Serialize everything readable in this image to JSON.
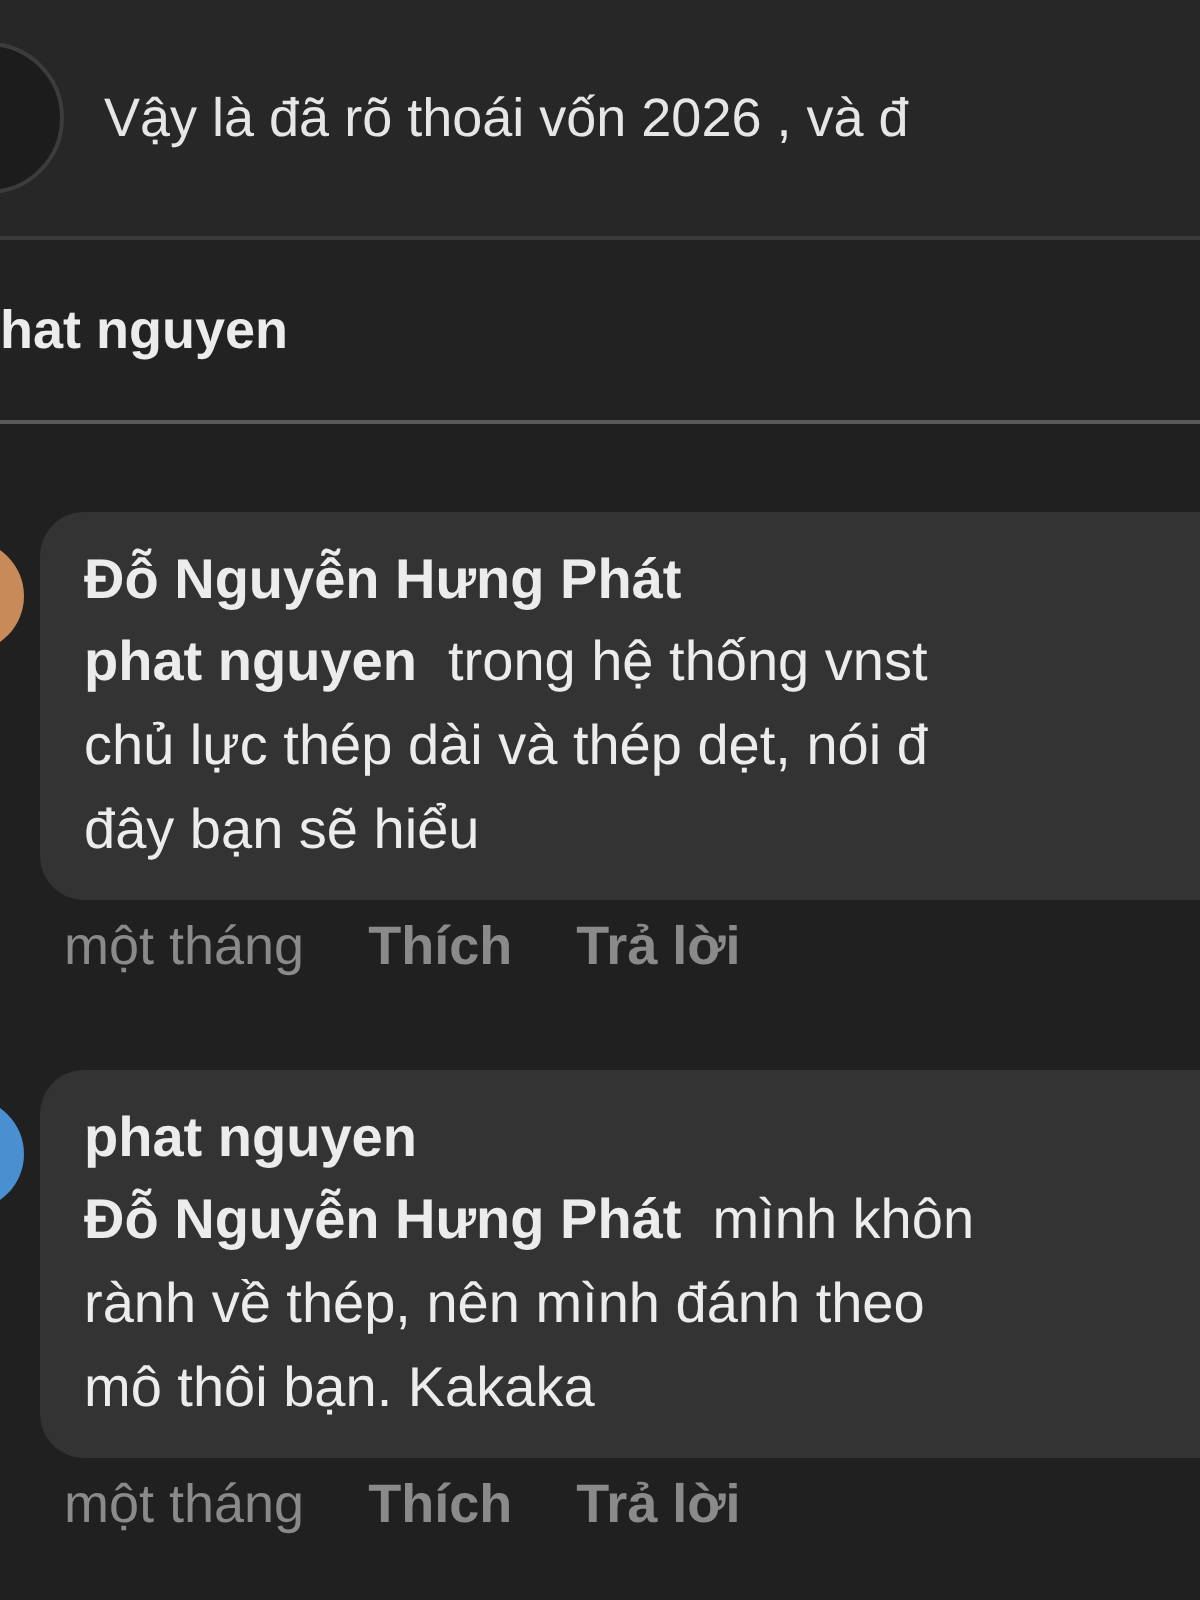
{
  "post_preview": {
    "text": "Vậy là đã rõ thoái vốn 2026 , và đ"
  },
  "reply_header": {
    "name": "hat nguyen"
  },
  "comments": [
    {
      "author": "Đỗ Nguyễn Hưng Phát",
      "color": "#c98a5a",
      "lines": [
        "**phat nguyen**  trong hệ thống vnst",
        "chủ lực thép dài và thép dẹt, nói đ",
        "đây bạn sẽ hiểu"
      ],
      "time": "một tháng",
      "like": "Thích",
      "reply": "Trả lời"
    },
    {
      "author": "phat nguyen",
      "color": "#4a90d0",
      "lines": [
        "**Đỗ Nguyễn Hưng Phát**  mình khôn",
        "rành về thép, nên mình đánh theo",
        "mô thôi bạn. Kakaka"
      ],
      "time": "một tháng",
      "like": "Thích",
      "reply": "Trả lời"
    }
  ]
}
